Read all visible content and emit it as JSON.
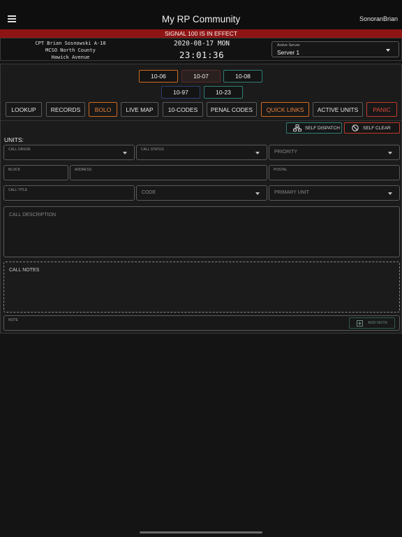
{
  "header": {
    "title": "My RP Community",
    "username": "SonoranBrian"
  },
  "signal_banner": "SIGNAL 100 IS IN EFFECT",
  "unit": {
    "line1": "CPT Brian Sosnowski A-10",
    "line2": "MCSO North County",
    "line3": "Hawick Avenue"
  },
  "clock": {
    "date": "2020-08-17 MON",
    "time": "23:01:36"
  },
  "server": {
    "label": "Active Server",
    "value": "Server 1"
  },
  "status_buttons": [
    "10-06",
    "10-07",
    "10-08",
    "10-97",
    "10-23"
  ],
  "nav_buttons": [
    "LOOKUP",
    "RECORDS",
    "BOLO",
    "LIVE MAP",
    "10-CODES",
    "PENAL CODES",
    "QUICK LINKS",
    "ACTIVE UNITS",
    "PANIC"
  ],
  "actions": {
    "self_dispatch": "SELF DISPATCH",
    "self_clear": "SELF CLEAR"
  },
  "units_label": "UNITS:",
  "form": {
    "call_origin": "CALL ORIGIN",
    "call_status": "CALL STATUS",
    "priority": "PRIORITY",
    "block": "BLOCK",
    "address": "ADDRESS",
    "postal": "POSTAL",
    "call_title": "CALL TITLE",
    "code": "CODE",
    "primary_unit": "PRIMARY UNIT",
    "call_description": "CALL DESCRIPTION",
    "call_notes": "CALL NOTES",
    "note": "NOTE",
    "add_note": "ADD NOTE"
  },
  "colors": {
    "banner_red": "#8f1414",
    "orange": "#d2691e",
    "teal": "#2f7f74",
    "navy": "#2b3f6f",
    "danger": "#c0392b"
  }
}
